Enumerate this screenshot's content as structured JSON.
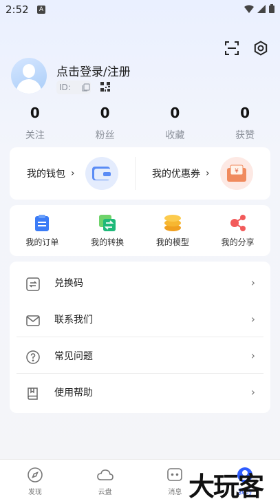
{
  "status": {
    "time": "2:52",
    "notification": "A"
  },
  "profile": {
    "login_text": "点击登录/注册",
    "id_label": "ID:"
  },
  "stats": [
    {
      "value": "0",
      "label": "关注"
    },
    {
      "value": "0",
      "label": "粉丝"
    },
    {
      "value": "0",
      "label": "收藏"
    },
    {
      "value": "0",
      "label": "获赞"
    }
  ],
  "wallet": {
    "wallet_label": "我的钱包",
    "coupon_label": "我的优惠券",
    "chevron": "›",
    "coupon_symbol": "¥"
  },
  "orders": [
    {
      "label": "我的订单",
      "icon": "order-icon"
    },
    {
      "label": "我的转换",
      "icon": "convert-icon"
    },
    {
      "label": "我的模型",
      "icon": "model-icon"
    },
    {
      "label": "我的分享",
      "icon": "share-icon"
    }
  ],
  "menu": [
    {
      "label": "兑换码",
      "icon": "redeem-icon"
    },
    {
      "label": "联系我们",
      "icon": "mail-icon"
    },
    {
      "label": "常见问题",
      "icon": "question-icon"
    },
    {
      "label": "使用帮助",
      "icon": "book-icon"
    }
  ],
  "menu_chevron": "›",
  "tabs": [
    {
      "label": "发现",
      "icon": "compass-icon"
    },
    {
      "label": "云盘",
      "icon": "cloud-icon"
    },
    {
      "label": "消息",
      "icon": "message-icon"
    },
    {
      "label": "我的",
      "icon": "profile-icon",
      "active": true
    }
  ],
  "watermark": "大玩客",
  "colors": {
    "accent": "#2e5cff",
    "bg": "#f4f5f8",
    "card": "#ffffff"
  }
}
